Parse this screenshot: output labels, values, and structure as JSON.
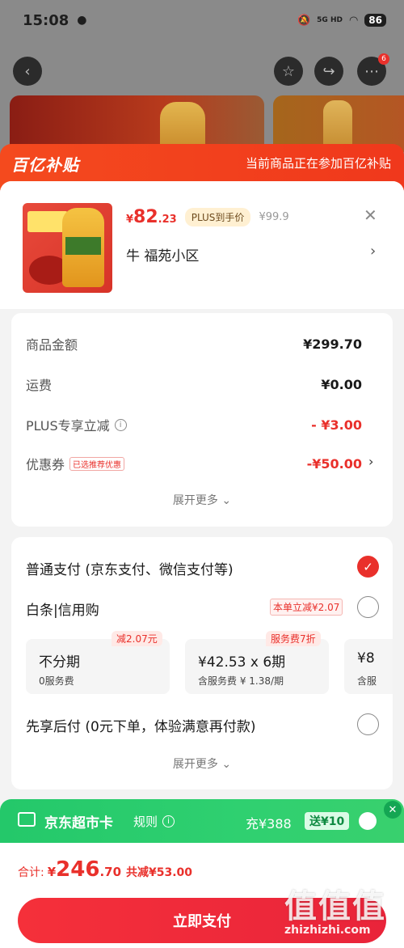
{
  "status_bar": {
    "time": "15:08",
    "network": "5G HD",
    "battery": "86"
  },
  "background": {
    "more_badge": "6"
  },
  "subsidy": {
    "logo": "百亿补贴",
    "note": "当前商品正在参加百亿补贴"
  },
  "product": {
    "price_currency": "¥",
    "price_int": "82",
    "price_dec": ".23",
    "plus_tag": "PLUS到手价",
    "original_price": "¥99.9",
    "address": "牛  福苑小区"
  },
  "summary": {
    "rows": [
      {
        "label": "商品金额",
        "value": "¥299.70"
      },
      {
        "label": "运费",
        "value": "¥0.00"
      },
      {
        "label": "PLUS专享立减",
        "value": "- ¥3.00"
      },
      {
        "label": "优惠券",
        "tag": "已选推荐优惠",
        "value": "-¥50.00"
      }
    ],
    "expand": "展开更多"
  },
  "payment": {
    "normal": "普通支付 (京东支付、微信支付等)",
    "baitiao": "白条|信用购",
    "baitiao_promo": "本单立减¥2.07",
    "plans": [
      {
        "tag": "减2.07元",
        "main": "不分期",
        "sub": "0服务费"
      },
      {
        "tag": "服务费7折",
        "main": "¥42.53 x 6期",
        "sub": "含服务费 ¥ 1.38/期"
      },
      {
        "main": "¥8",
        "sub": "含服"
      }
    ],
    "later": "先享后付 (0元下单，体验满意再付款)",
    "expand": "展开更多"
  },
  "jd_card": {
    "title": "京东超市卡",
    "rule": "规则",
    "charge": "充¥388",
    "bonus": "送¥10"
  },
  "footer": {
    "total_label": "合计:",
    "total_currency": "¥",
    "total_int": "246",
    "total_dec": ".70",
    "saved": "共减¥53.00",
    "pay_button": "立即支付"
  },
  "watermark": {
    "logo": "值值值",
    "site": "zhizhizhi.com"
  }
}
